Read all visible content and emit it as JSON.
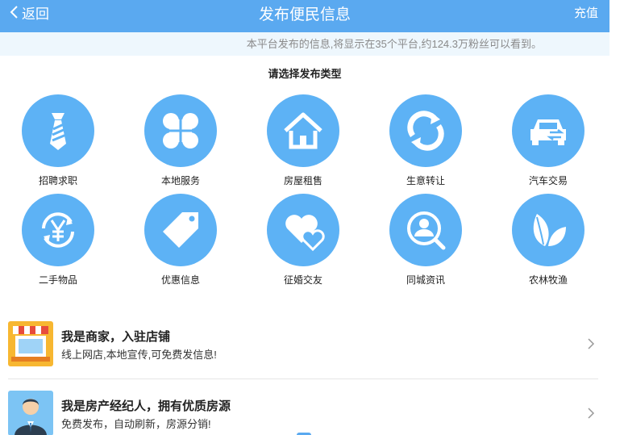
{
  "header": {
    "back_label": "返回",
    "title": "发布便民信息",
    "recharge_label": "充值"
  },
  "notice": {
    "text": "本平台发布的信息,将显示在35个平台,约124.3万粉丝可以看到。"
  },
  "prompt": {
    "text": "请选择发布类型"
  },
  "categories": [
    {
      "label": "招聘求职",
      "icon": "tie-icon"
    },
    {
      "label": "本地服务",
      "icon": "clover-icon"
    },
    {
      "label": "房屋租售",
      "icon": "house-icon"
    },
    {
      "label": "生意转让",
      "icon": "refresh-icon"
    },
    {
      "label": "汽车交易",
      "icon": "car-icon"
    },
    {
      "label": "二手物品",
      "icon": "yuan-cycle-icon"
    },
    {
      "label": "优惠信息",
      "icon": "tag-icon"
    },
    {
      "label": "征婚交友",
      "icon": "hearts-icon"
    },
    {
      "label": "同城资讯",
      "icon": "person-search-icon"
    },
    {
      "label": "农林牧渔",
      "icon": "leaves-icon"
    }
  ],
  "promos": [
    {
      "title": "我是商家，入驻店铺",
      "subtitle": "线上网店,本地宣传,可免费发信息!",
      "icon": "storefront-icon"
    },
    {
      "title": "我是房产经纪人，拥有优质房源",
      "subtitle": "免费发布，自动刷新，房源分销!",
      "icon": "agent-avatar-icon"
    }
  ],
  "colors": {
    "header_bg": "#5aa9f0",
    "notice_bg": "#eef7fd",
    "icon_circle": "#5db2f5"
  }
}
